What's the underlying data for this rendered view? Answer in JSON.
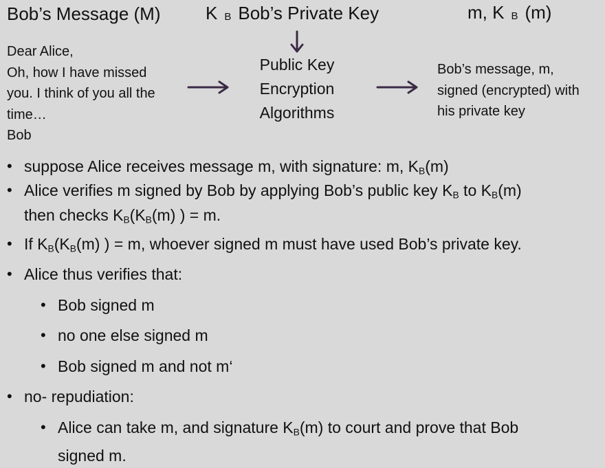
{
  "diagram": {
    "message_title": "Bob’s Message (M)",
    "key_letter": "K",
    "key_sub": "B",
    "key_title": "Bob’s Private Key",
    "signed_prefix": "m, K",
    "signed_sub": "B",
    "signed_suffix": "(m)",
    "letter": [
      "Dear Alice,",
      "Oh, how I have missed",
      "you. I think of you all the",
      "time…",
      "Bob"
    ],
    "algorithm": [
      "Public Key",
      "Encryption",
      "Algorithms"
    ],
    "result": [
      "Bob’s message, m,",
      "signed  (encrypted) with",
      "his private key"
    ]
  },
  "bullets": {
    "b1": {
      "a": "suppose Alice receives message m, with signature: m, K",
      "s": "B",
      "b": "(m)"
    },
    "b2_l1": {
      "a": "Alice verifies m signed by Bob by applying Bob’s public key K",
      "s1": "B",
      "b": " to K",
      "s2": "B",
      "c": "(m)"
    },
    "b2_l2": {
      "a": "then checks K",
      "s1": "B",
      "b": "(K",
      "s2": "B",
      "c": "(m) ) = m."
    },
    "b3": {
      "a": "If K",
      "s1": "B",
      "b": "(K",
      "s2": "B",
      "c": "(m) ) = m, whoever signed m must have used Bob’s private key."
    },
    "b4": "Alice thus verifies that:",
    "b4_1": "Bob signed m",
    "b4_2": "no one else signed m",
    "b4_3": "Bob signed m and not m‘",
    "b5": "no- repudiation:",
    "b5_1": {
      "a": "Alice can take m, and signature K",
      "s": "B",
      "b": "(m) to court and prove that Bob"
    },
    "b5_1_cont": "signed m."
  },
  "colors": {
    "background": "#d9d9d9",
    "arrow": "#3a2a45"
  }
}
